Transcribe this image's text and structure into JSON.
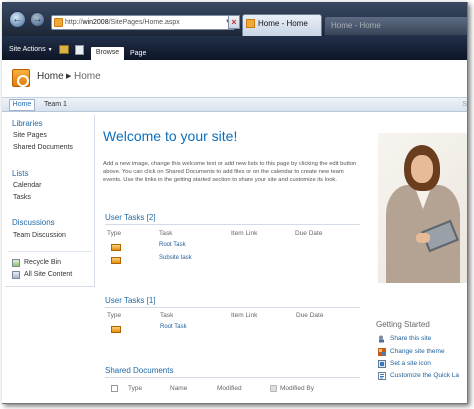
{
  "browser": {
    "address_prefix": "http://",
    "address_host": "win2008",
    "address_path": "/SitePages/Home.aspx",
    "tab_title": "Home - Home",
    "tab_title_dim": "Home - Home"
  },
  "ribbon": {
    "site_actions": "Site Actions",
    "tabs": [
      "Browse",
      "Page"
    ]
  },
  "breadcrumb": {
    "root": "Home",
    "current": "Home"
  },
  "top_nav": {
    "items": [
      "Home",
      "Team 1"
    ]
  },
  "quick_launch": {
    "libraries": {
      "heading": "Libraries",
      "items": [
        "Site Pages",
        "Shared Documents"
      ]
    },
    "lists": {
      "heading": "Lists",
      "items": [
        "Calendar",
        "Tasks"
      ]
    },
    "discussions": {
      "heading": "Discussions",
      "items": [
        "Team Discussion"
      ]
    },
    "footer": [
      "Recycle Bin",
      "All Site Content"
    ]
  },
  "main": {
    "welcome_title": "Welcome to your site!",
    "welcome_text": "Add a new image, change this welcome text or add new lists to this page by clicking the edit button above. You can click on Shared Documents to add files or on the calendar to create new team events. Use the links in the getting started section to share your site and customize its look."
  },
  "user_tasks_2": {
    "title": "User Tasks [2]",
    "columns": [
      "Type",
      "Task",
      "Item Link",
      "Due Date"
    ],
    "rows": [
      {
        "task": "Root Task"
      },
      {
        "task": "Subsite task"
      }
    ]
  },
  "user_tasks_1": {
    "title": "User Tasks [1]",
    "columns": [
      "Type",
      "Task",
      "Item Link",
      "Due Date"
    ],
    "rows": [
      {
        "task": "Root Task"
      }
    ]
  },
  "shared_documents": {
    "title": "Shared Documents",
    "columns": [
      "Type",
      "Name",
      "Modified",
      "Modified By"
    ]
  },
  "getting_started": {
    "title": "Getting Started",
    "links": [
      "Share this site",
      "Change site theme",
      "Set a site icon",
      "Customize the Quick La"
    ]
  },
  "colors": {
    "accent_blue": "#0b6fbf",
    "ribbon_dark": "#0d1526",
    "logo_orange": "#e27b0d"
  },
  "icons": {
    "back": "back-arrow-icon",
    "site_logo": "site-logo-icon",
    "task_type": "task-type-icon"
  }
}
